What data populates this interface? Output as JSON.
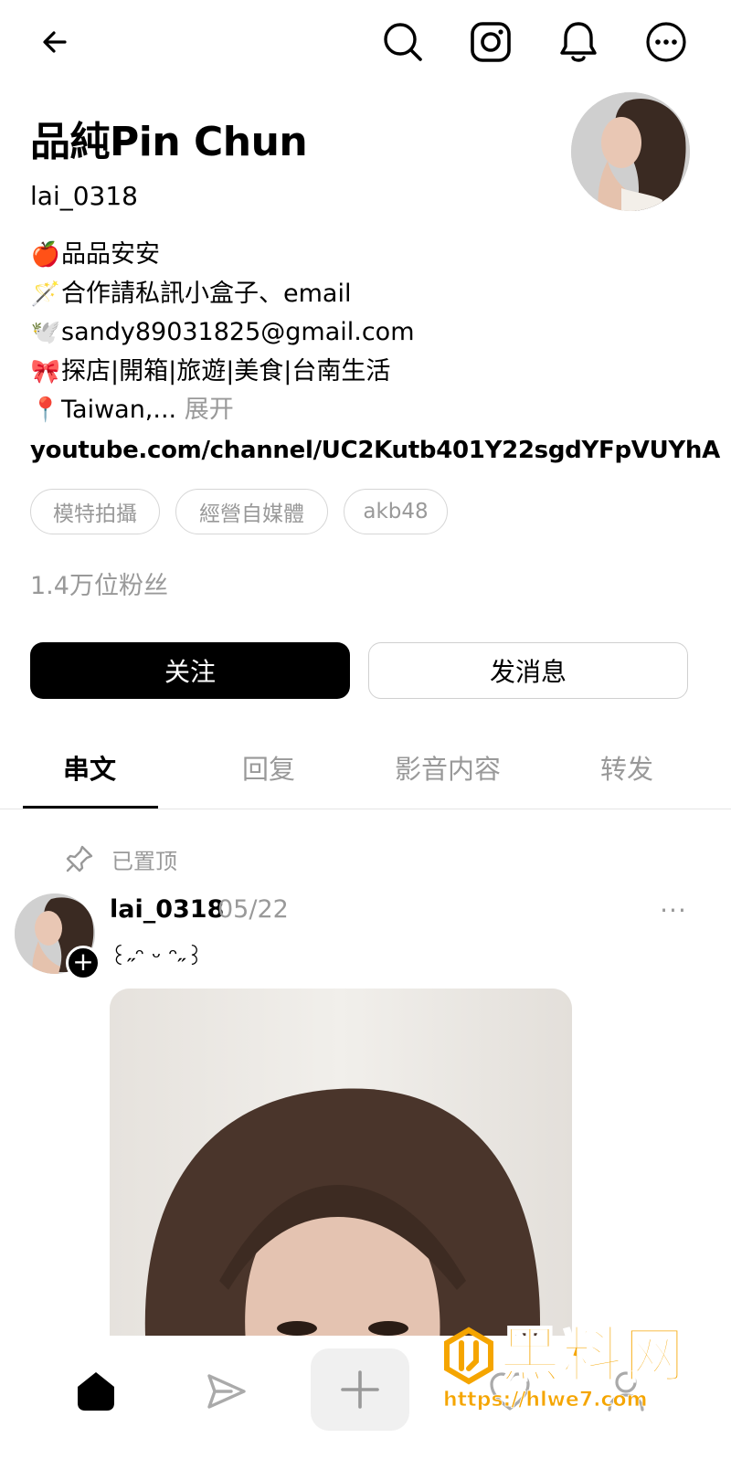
{
  "profile": {
    "display_name": "品純Pin Chun",
    "handle": "lai_0318",
    "bio": [
      {
        "emoji": "🍎",
        "text": "品品安安"
      },
      {
        "emoji": "🪄",
        "text": "合作請私訊小盒子、email"
      },
      {
        "emoji": "🕊️",
        "text": "sandy89031825@gmail.com"
      },
      {
        "emoji": "🎀",
        "text": "探店|開箱|旅遊|美食|台南生活"
      },
      {
        "emoji": "📍",
        "text": "Taiwan,..."
      }
    ],
    "expand_label": "展开",
    "link": "youtube.com/channel/UC2Kutb401Y22sgdYFpVUYhA",
    "tags": [
      "模特拍攝",
      "經營自媒體",
      "akb48"
    ],
    "followers": "1.4万位粉丝"
  },
  "actions": {
    "follow_label": "关注",
    "message_label": "发消息"
  },
  "tabs": [
    {
      "label": "串文",
      "active": true
    },
    {
      "label": "回复",
      "active": false
    },
    {
      "label": "影音内容",
      "active": false
    },
    {
      "label": "转发",
      "active": false
    }
  ],
  "post": {
    "pinned_label": "已置顶",
    "username": "lai_0318",
    "date": "05/22",
    "text": "꒰˶ᵔ ᵕ ᵔ˶꒱",
    "more_label": "···"
  },
  "watermark": {
    "brand": "黑料网",
    "url": "https://hlwe7.com"
  },
  "icons": {
    "back": "arrow-left-icon",
    "search": "search-icon",
    "instagram": "instagram-icon",
    "notifications": "bell-icon",
    "more": "more-circle-icon"
  },
  "colors": {
    "primary": "#000000",
    "muted": "#999999",
    "border": "#d6d6d6",
    "watermark": "#f5a500"
  }
}
